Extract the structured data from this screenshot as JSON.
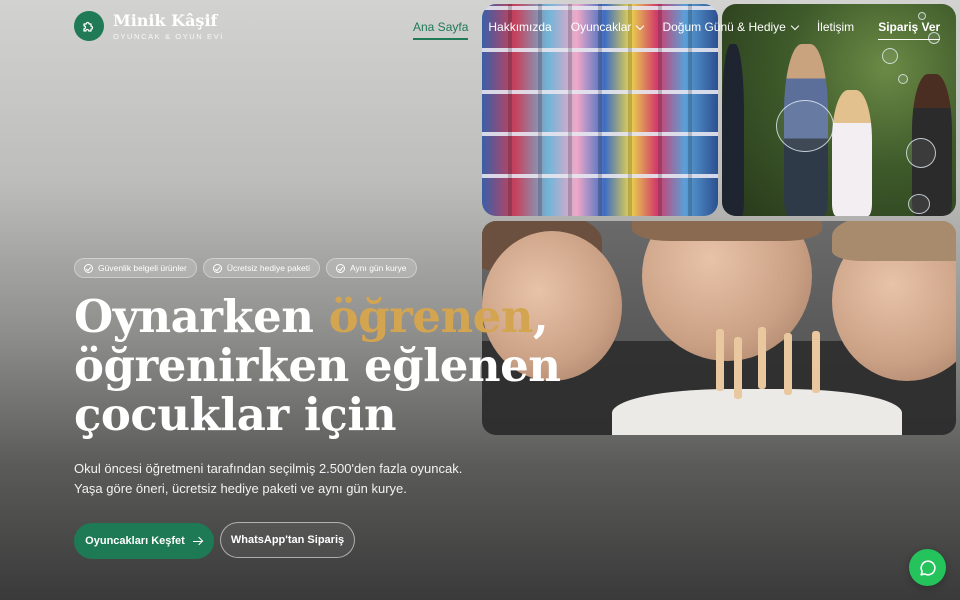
{
  "brand": {
    "name": "Minik Kâşif",
    "tagline": "OYUNCAK & OYUN EVİ",
    "logo_icon": "puzzle-icon",
    "accent_color": "#1f7a55"
  },
  "nav": {
    "items": [
      {
        "label": "Ana Sayfa",
        "active": true
      },
      {
        "label": "Hakkımızda"
      },
      {
        "label": "Oyuncaklar",
        "dropdown": true
      },
      {
        "label": "Doğum Günü & Hediye",
        "dropdown": true
      },
      {
        "label": "İletişim"
      }
    ],
    "cta_label": "Sipariş Ver"
  },
  "hero": {
    "badges": [
      "Güvenlik belgeli ürünler",
      "Ücretsiz hediye paketi",
      "Aynı gün kurye"
    ],
    "headline": {
      "part1": "Oynarken ",
      "accent": "öğrenen",
      "part2": ",",
      "line2": "öğrenirken eğlenen",
      "line3": "çocuklar için"
    },
    "headline_accent_color": "#d4a550",
    "lead_line1": "Okul öncesi öğretmeni tarafından seçilmiş 2.500'den fazla oyuncak.",
    "lead_line2": "Yaşa göre öneri, ücretsiz hediye paketi ve aynı gün kurye.",
    "primary_button": "Oyuncakları Keşfet",
    "secondary_button": "WhatsApp'tan Sipariş"
  },
  "chat": {
    "icon": "chat-bubble-icon",
    "color": "#25c35b"
  }
}
